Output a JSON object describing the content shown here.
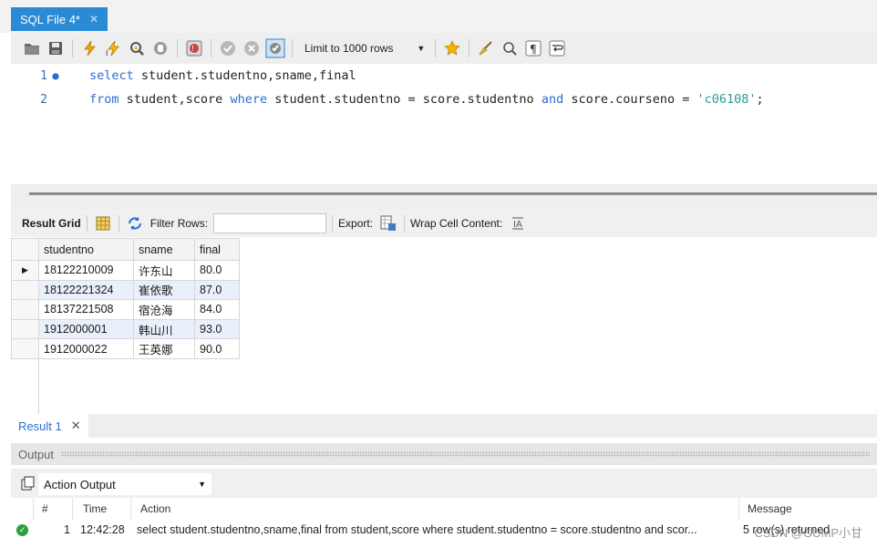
{
  "tab": {
    "label": "SQL File 4*",
    "close": "✕"
  },
  "toolbar": {
    "limit_label": "Limit to 1000 rows",
    "caret": "▼"
  },
  "editor": {
    "lines": [
      {
        "number": "1",
        "marker": "●"
      },
      {
        "number": "2",
        "marker": ""
      }
    ],
    "line1": [
      {
        "t": "select",
        "k": "kw"
      },
      {
        "t": " student.studentno,sname,final",
        "k": ""
      }
    ],
    "line2": [
      {
        "t": "from",
        "k": "kw"
      },
      {
        "t": " student,score ",
        "k": ""
      },
      {
        "t": "where",
        "k": "kw"
      },
      {
        "t": " student.studentno = score.studentno ",
        "k": ""
      },
      {
        "t": "and",
        "k": "kw"
      },
      {
        "t": " score.courseno = ",
        "k": ""
      },
      {
        "t": "'c06108'",
        "k": "str"
      },
      {
        "t": ";",
        "k": ""
      }
    ]
  },
  "result_toolbar": {
    "result_grid": "Result Grid",
    "filter_rows": "Filter Rows:",
    "filter_value": "",
    "export": "Export:",
    "wrap": "Wrap Cell Content:"
  },
  "grid": {
    "columns": [
      "studentno",
      "sname",
      "final"
    ],
    "current_row_marker": "▶",
    "rows": [
      [
        "18122210009",
        "许东山",
        "80.0"
      ],
      [
        "18122221324",
        "崔依歌",
        "87.0"
      ],
      [
        "18137221508",
        "宿沧海",
        "84.0"
      ],
      [
        "1912000001",
        "韩山川",
        "93.0"
      ],
      [
        "1912000022",
        "王英娜",
        "90.0"
      ]
    ]
  },
  "result_tab": {
    "label": "Result 1",
    "close": "✕"
  },
  "output": {
    "title": "Output",
    "selector": "Action Output",
    "caret": "▼",
    "headers": {
      "num": "#",
      "time": "Time",
      "action": "Action",
      "message": "Message"
    },
    "row": {
      "num": "1",
      "time": "12:42:28",
      "action": "select student.studentno,sname,final from student,score where student.studentno = score.studentno and scor...",
      "message": "5 row(s) returned"
    }
  },
  "watermark": "CSDN @GUMP小甘",
  "colors": {
    "accent": "#2a8ad4",
    "keyword": "#2a6fcf",
    "string": "#2a9d8f",
    "alt_row": "#e9f0fb",
    "ok": "#2e9e3e"
  },
  "icons": [
    "open-folder-icon",
    "save-icon",
    "execute-lightning-icon",
    "execute-current-lightning-icon",
    "explain-magnifier-icon",
    "stop-icon",
    "toggle-error-icon",
    "commit-icon",
    "rollback-icon",
    "autocommit-icon",
    "beautify-star-icon",
    "broom-icon",
    "find-icon",
    "invisible-chars-icon",
    "wrap-icon"
  ]
}
